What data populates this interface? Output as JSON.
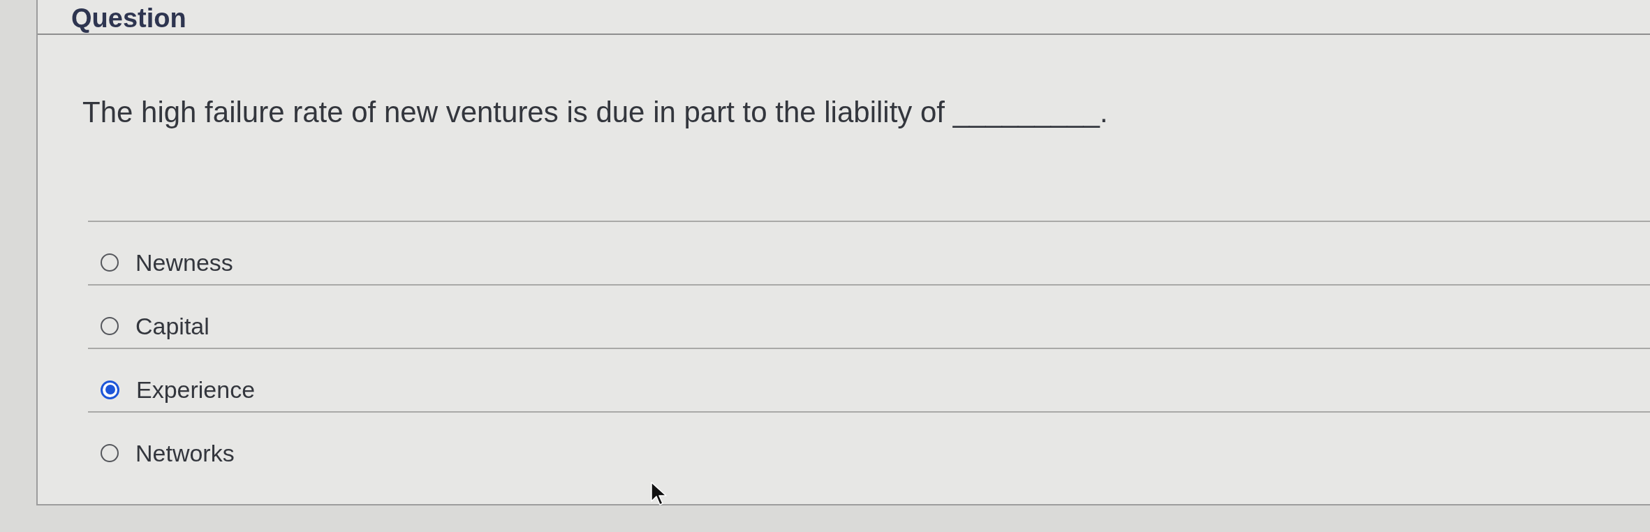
{
  "header": {
    "title": "Question"
  },
  "question": {
    "text": "The high failure rate of new ventures is due in part to the liability of _________."
  },
  "options": [
    {
      "label": "Newness",
      "selected": false
    },
    {
      "label": "Capital",
      "selected": false
    },
    {
      "label": "Experience",
      "selected": true
    },
    {
      "label": "Networks",
      "selected": false
    }
  ]
}
